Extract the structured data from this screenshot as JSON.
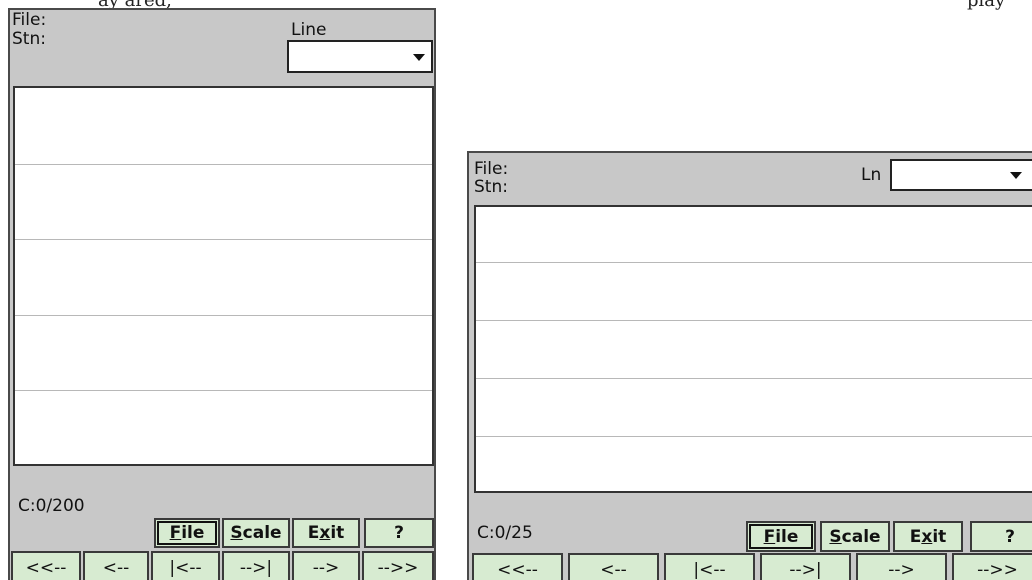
{
  "top_text": {
    "left": "ay ared,",
    "right": "play"
  },
  "screens": [
    {
      "file_label": "File:",
      "stn_label": "Stn:",
      "selector_label": "Line",
      "selector_value": "",
      "counter": "C:0/200",
      "func_buttons": [
        {
          "pre": "",
          "ul": "F",
          "post": "ile"
        },
        {
          "pre": "",
          "ul": "S",
          "post": "cale"
        },
        {
          "pre": "E",
          "ul": "x",
          "post": "it"
        },
        {
          "pre": "",
          "ul": "",
          "post": "?"
        }
      ],
      "nav_buttons": [
        "<<--",
        "<--",
        "|<--",
        "-->|",
        "-->",
        "-->>"
      ]
    },
    {
      "file_label": "File:",
      "stn_label": "Stn:",
      "selector_label": "Ln",
      "selector_value": "",
      "counter": "C:0/25",
      "func_buttons": [
        {
          "pre": "",
          "ul": "F",
          "post": "ile"
        },
        {
          "pre": "",
          "ul": "S",
          "post": "cale"
        },
        {
          "pre": "E",
          "ul": "x",
          "post": "it"
        },
        {
          "pre": "",
          "ul": "",
          "post": "?"
        }
      ],
      "nav_buttons": [
        "<<--",
        "<--",
        "|<--",
        "-->|",
        "-->",
        "-->>"
      ]
    }
  ]
}
